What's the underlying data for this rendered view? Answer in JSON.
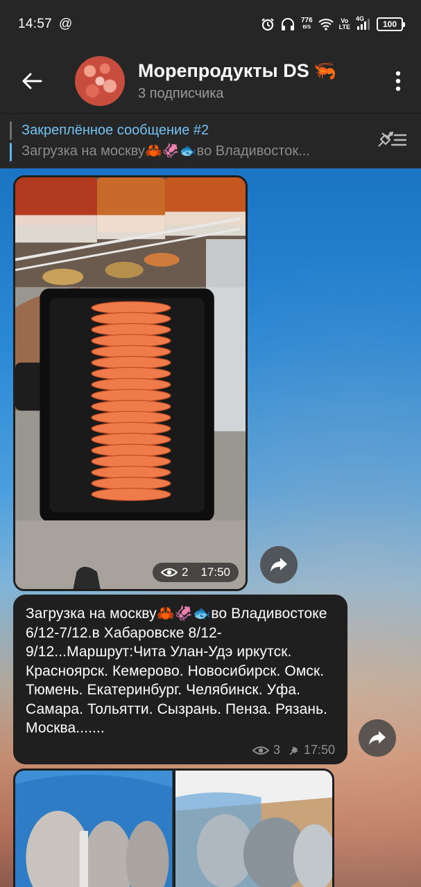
{
  "status_bar": {
    "time": "14:57",
    "at_symbol": "@",
    "net_speed_value": "776",
    "net_speed_unit": "B/S",
    "volte_top": "Vo",
    "volte_bottom": "LTE",
    "network": "4G",
    "battery": "100"
  },
  "header": {
    "title": "Морепродукты DS",
    "title_emoji": "🦐",
    "subtitle": "3 подписчика"
  },
  "pinned": {
    "title": "Закреплённое сообщение #2",
    "preview": "Загрузка на москву🦀🦑🐟во Владивосток..."
  },
  "messages": {
    "photo": {
      "views": "2",
      "time": "17:50"
    },
    "text": {
      "body": "Загрузка на москву🦀🦑🐟во Владивостоке 6/12-7/12.в Хабаровске 8/12-9/12...Маршрут:Чита Улан-Удэ иркутск. Красноярск. Кемерово. Новосибирск. Омск. Тюмень. Екатеринбург. Челябинск. Уфа. Самара. Тольятти. Сызрань. Пенза. Рязань. Москва.......",
      "views": "3",
      "time": "17:50"
    }
  },
  "colors": {
    "bar_bg": "#262626",
    "accent": "#74c2f2",
    "bubble_bg": "#1f1f1f"
  }
}
